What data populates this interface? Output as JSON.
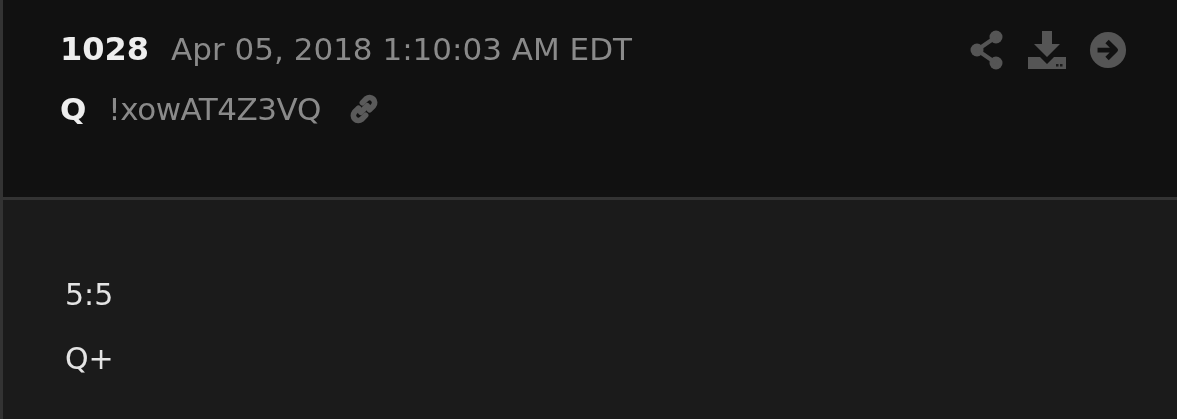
{
  "post": {
    "number": "1028",
    "timestamp": "Apr 05, 2018 1:10:03 AM EDT",
    "author": "Q",
    "tripcode": "!xowAT4Z3VQ",
    "lines": [
      "5:5",
      "Q+"
    ]
  }
}
